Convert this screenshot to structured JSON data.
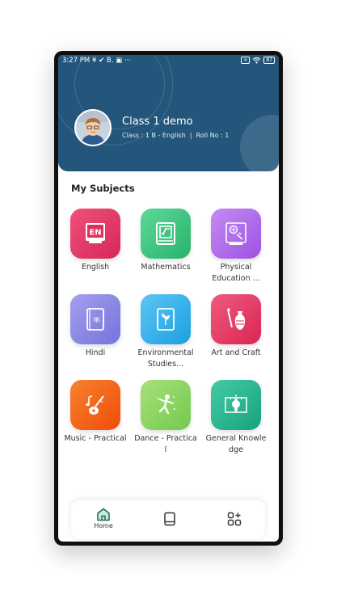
{
  "status_bar": {
    "time": "3:27 PM",
    "left_icons_text": "¥ ✔ B. ▣  ···",
    "battery": "87"
  },
  "profile": {
    "name": "Class 1 demo",
    "class_info": "Class : 1 B - English",
    "roll_no": "Roll No : 1"
  },
  "section_title": "My Subjects",
  "subjects": [
    {
      "label": "English",
      "icon": "english-icon",
      "color": "#e0305e",
      "color2": "#f0507a"
    },
    {
      "label": "Mathematics",
      "icon": "mathematics-icon",
      "color": "#2fbf71",
      "color2": "#5ed89a"
    },
    {
      "label": "Physical Education ...",
      "icon": "physical-education-icon",
      "color": "#a55ce6",
      "color2": "#c48cf2"
    },
    {
      "label": "Hindi",
      "icon": "hindi-icon",
      "color": "#7d7ae0",
      "color2": "#a3a0ee"
    },
    {
      "label": "Environmental Studies...",
      "icon": "environmental-studies-icon",
      "color": "#22a7e6",
      "color2": "#5cc6f5"
    },
    {
      "label": "Art and Craft",
      "icon": "art-and-craft-icon",
      "color": "#e02b5b",
      "color2": "#f05a7e"
    },
    {
      "label": "Music - Practical",
      "icon": "music-icon",
      "color": "#f2570f",
      "color2": "#f7812e"
    },
    {
      "label": "Dance - Practical",
      "icon": "dance-icon",
      "color": "#7fcf5a",
      "color2": "#a8e07a"
    },
    {
      "label": "General Knowledge",
      "icon": "general-knowledge-icon",
      "color": "#1cae8a",
      "color2": "#46c9a5"
    }
  ],
  "nav": {
    "home_label": "Home",
    "accent": "#1fa37a"
  }
}
